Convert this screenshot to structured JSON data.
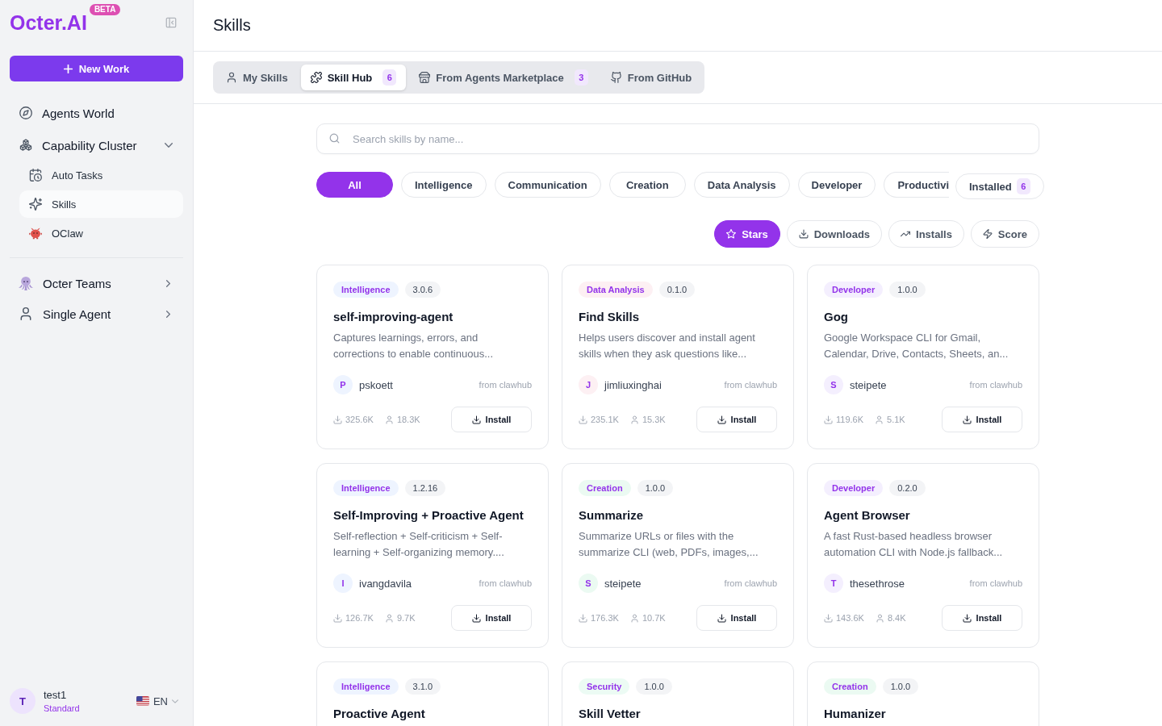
{
  "sidebar": {
    "logo": "Octer.AI",
    "badge": "BETA",
    "new_work_button": "New Work",
    "nav_sections": [
      {
        "items": [
          {
            "label": "Agents World",
            "kind": "link"
          },
          {
            "label": "Capability Cluster",
            "kind": "group",
            "expanded": true,
            "children": [
              {
                "label": "Auto Tasks",
                "selected": false
              },
              {
                "label": "Skills",
                "selected": true
              },
              {
                "label": "OClaw",
                "selected": false
              }
            ]
          }
        ]
      },
      {
        "items": [
          {
            "label": "Octer Teams",
            "kind": "group",
            "expanded": false
          },
          {
            "label": "Single Agent",
            "kind": "group",
            "expanded": false
          }
        ]
      }
    ],
    "user": {
      "initial": "T",
      "name": "test1",
      "plan": "Standard",
      "language": "EN"
    }
  },
  "page_title": "Skills",
  "tabs": [
    {
      "label": "My Skills",
      "selected": false
    },
    {
      "label": "Skill Hub",
      "selected": true,
      "count": "6"
    },
    {
      "label": "From Agents Marketplace",
      "selected": false,
      "count": "3"
    },
    {
      "label": "From GitHub",
      "selected": false
    }
  ],
  "search": {
    "placeholder": "Search skills by name..."
  },
  "categories": [
    {
      "label": "All",
      "selected": true,
      "clipped": false
    },
    {
      "label": "Intelligence",
      "selected": false,
      "clipped": false
    },
    {
      "label": "Communication",
      "selected": false,
      "clipped": false
    },
    {
      "label": "Creation",
      "selected": false,
      "clipped": false
    },
    {
      "label": "Data Analysis",
      "selected": false,
      "clipped": false
    },
    {
      "label": "Developer",
      "selected": false,
      "clipped": false
    },
    {
      "label": "Productivi",
      "selected": false,
      "clipped": true
    }
  ],
  "installed_filter": {
    "label": "Installed",
    "count": "6",
    "selected": false
  },
  "sort_options": [
    {
      "label": "Stars",
      "selected": true
    },
    {
      "label": "Downloads",
      "selected": false
    },
    {
      "label": "Installs",
      "selected": false
    },
    {
      "label": "Score",
      "selected": false
    }
  ],
  "cards": [
    {
      "category": "Intelligence",
      "color": "#eef4ff",
      "version": "3.0.6",
      "title": "self-improving-agent",
      "description": "Captures learnings, errors, and corrections to enable continuous...",
      "author_initial": "P",
      "author": "pskoett",
      "source": "from clawhub",
      "downloads": "325.6K",
      "users": "18.3K",
      "button": "Install"
    },
    {
      "category": "Data Analysis",
      "color": "#fdf0f3",
      "version": "0.1.0",
      "title": "Find Skills",
      "description": "Helps users discover and install agent skills when they ask questions like...",
      "author_initial": "J",
      "author": "jimliuxinghai",
      "source": "from clawhub",
      "downloads": "235.1K",
      "users": "15.3K",
      "button": "Install"
    },
    {
      "category": "Developer",
      "color": "#f4effe",
      "version": "1.0.0",
      "title": "Gog",
      "description": "Google Workspace CLI for Gmail, Calendar, Drive, Contacts, Sheets, an...",
      "author_initial": "S",
      "author": "steipete",
      "source": "from clawhub",
      "downloads": "119.6K",
      "users": "5.1K",
      "button": "Install"
    },
    {
      "category": "Intelligence",
      "color": "#eef4ff",
      "version": "1.2.16",
      "title": "Self-Improving + Proactive Agent",
      "description": "Self-reflection + Self-criticism + Self-learning + Self-organizing memory....",
      "author_initial": "I",
      "author": "ivangdavila",
      "source": "from clawhub",
      "downloads": "126.7K",
      "users": "9.7K",
      "button": "Install"
    },
    {
      "category": "Creation",
      "color": "#ebfaf2",
      "version": "1.0.0",
      "title": "Summarize",
      "description": "Summarize URLs or files with the summarize CLI (web, PDFs, images,...",
      "author_initial": "S",
      "author": "steipete",
      "source": "from clawhub",
      "downloads": "176.3K",
      "users": "10.7K",
      "button": "Install"
    },
    {
      "category": "Developer",
      "color": "#f4effe",
      "version": "0.2.0",
      "title": "Agent Browser",
      "description": "A fast Rust-based headless browser automation CLI with Node.js fallback...",
      "author_initial": "T",
      "author": "thesethrose",
      "source": "from clawhub",
      "downloads": "143.6K",
      "users": "8.4K",
      "button": "Install"
    },
    {
      "category": "Intelligence",
      "color": "#eef4ff",
      "version": "3.1.0",
      "title": "Proactive Agent"
    },
    {
      "category": "Security",
      "color": "#ecfbf4",
      "version": "1.0.0",
      "title": "Skill Vetter"
    },
    {
      "category": "Creation",
      "color": "#ebfaf2",
      "version": "1.0.0",
      "title": "Humanizer"
    }
  ]
}
